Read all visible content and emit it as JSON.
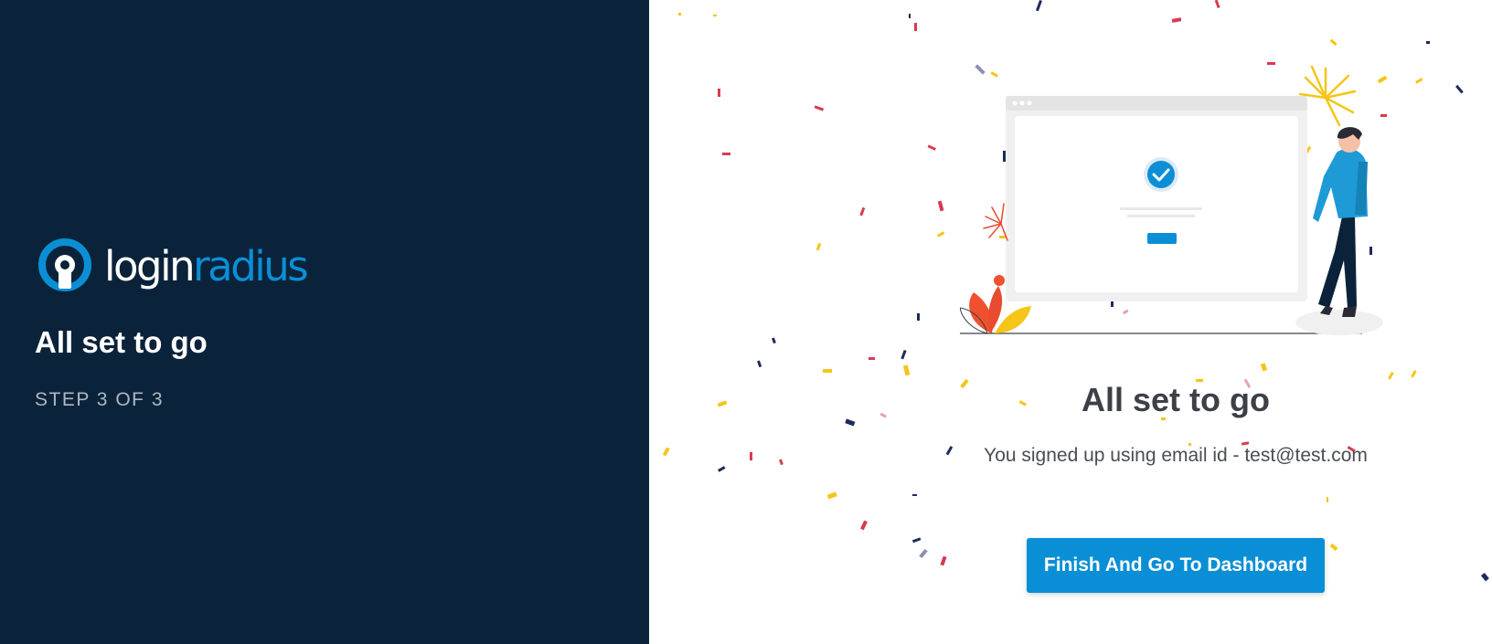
{
  "brand": {
    "name_part1": "login",
    "name_part2": "radius",
    "color_primary": "#0a8fd6",
    "color_panel": "#0b233a"
  },
  "sidebar": {
    "title": "All set to go",
    "step": "STEP 3 OF 3"
  },
  "main": {
    "title": "All set to go",
    "message": "You signed up using email id - test@test.com",
    "button_label": "Finish And Go To Dashboard"
  },
  "illustration": {
    "icons": [
      "browser-window-icon",
      "checkmark-circle-icon",
      "person-icon",
      "fireworks-icon",
      "plant-icon",
      "confetti-pattern"
    ]
  }
}
